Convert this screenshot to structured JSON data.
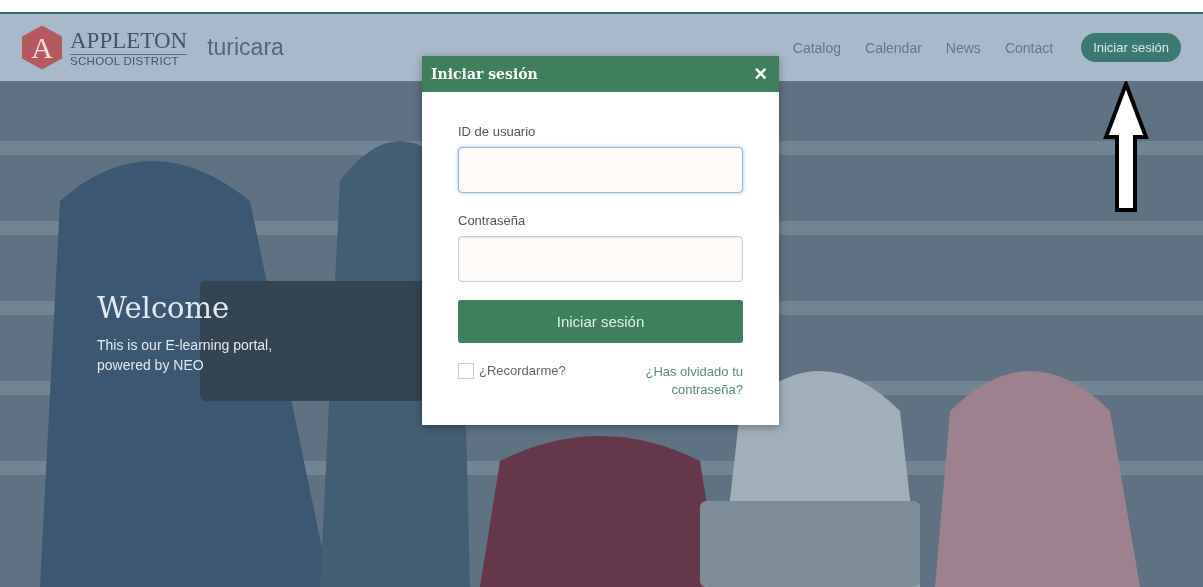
{
  "header": {
    "logo": {
      "letter": "A",
      "name": "APPLETON",
      "subtitle": "SCHOOL DISTRICT"
    },
    "site_name": "turicara",
    "nav": [
      "Catalog",
      "Calendar",
      "News",
      "Contact"
    ],
    "login_button": "Iniciar sesión"
  },
  "hero": {
    "kind": "picture",
    "title": "Welcome",
    "text": "This is our E-learning portal, powered by NEO"
  },
  "modal": {
    "title": "Iniciar sesión",
    "close": "×",
    "fields": [
      {
        "label": "ID de usuario",
        "focused": true
      },
      {
        "label": "Contraseña",
        "focused": false
      }
    ],
    "submit": "Iniciar sesión",
    "remember": {
      "label": "¿Recordarme?",
      "checked": false
    },
    "forgot_link": "¿Has olvidado tu contraseña?"
  }
}
